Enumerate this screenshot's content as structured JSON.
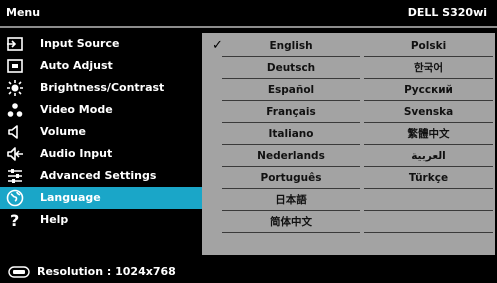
{
  "header": {
    "menu_title": "Menu",
    "model": "DELL S320wi"
  },
  "menu": [
    {
      "label": "Input Source",
      "icon": "input-source-icon",
      "selected": false
    },
    {
      "label": "Auto Adjust",
      "icon": "auto-adjust-icon",
      "selected": false
    },
    {
      "label": "Brightness/Contrast",
      "icon": "brightness-icon",
      "selected": false
    },
    {
      "label": "Video Mode",
      "icon": "video-mode-icon",
      "selected": false
    },
    {
      "label": "Volume",
      "icon": "volume-icon",
      "selected": false
    },
    {
      "label": "Audio Input",
      "icon": "audio-input-icon",
      "selected": false
    },
    {
      "label": "Advanced Settings",
      "icon": "advanced-settings-icon",
      "selected": false
    },
    {
      "label": "Language",
      "icon": "globe-icon",
      "selected": true
    },
    {
      "label": "Help",
      "icon": "help-icon",
      "selected": false
    }
  ],
  "languages": {
    "col1": [
      "English",
      "Deutsch",
      "Español",
      "Français",
      "Italiano",
      "Nederlands",
      "Português",
      "日本語",
      "简体中文"
    ],
    "col2": [
      "Polski",
      "한국어",
      "Русский",
      "Svenska",
      "繁體中文",
      "العربية",
      "Türkçe",
      "",
      ""
    ],
    "selected": "English"
  },
  "footer": {
    "resolution": "Resolution : 1024x768"
  },
  "colors": {
    "highlight": "#1aa6c8",
    "panel": "#a3a3a3",
    "background": "#000000"
  }
}
